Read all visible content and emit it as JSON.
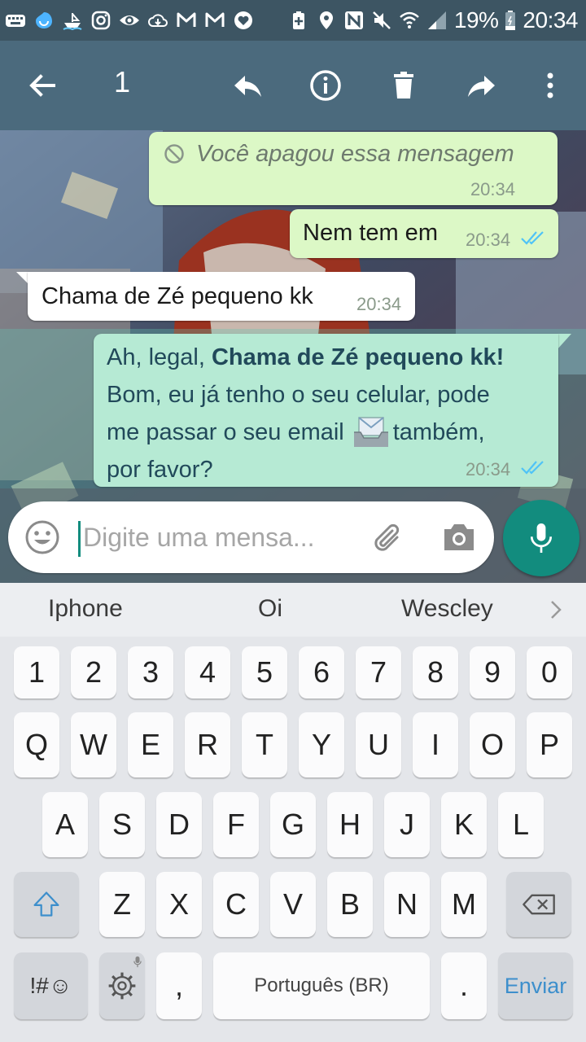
{
  "status_bar": {
    "battery": "19%",
    "time": "20:34",
    "left_icons": [
      "keyboard-icon",
      "drop-icon",
      "ship-icon",
      "instagram-icon",
      "eye-icon",
      "cloud-icon",
      "gmail-icon",
      "gmail-icon",
      "heart-icon"
    ],
    "right_icons": [
      "battery-saver-icon",
      "location-icon",
      "nfc-icon",
      "mute-icon",
      "wifi-icon",
      "signal-icon",
      "battery-icon"
    ]
  },
  "action_bar": {
    "selected_count": "1",
    "icons": [
      "back-arrow-icon",
      "reply-icon",
      "info-icon",
      "delete-icon",
      "forward-icon",
      "more-vert-icon"
    ]
  },
  "messages": [
    {
      "type": "outgoing-deleted",
      "text": "Você apagou essa mensagem",
      "time": "20:34"
    },
    {
      "type": "outgoing",
      "text": "Nem tem em",
      "time": "20:34",
      "status": "read"
    },
    {
      "type": "incoming",
      "text": "Chama de Zé pequeno kk",
      "time": "20:34"
    },
    {
      "type": "outgoing-selected",
      "text_prefix": "Ah, legal, ",
      "text_bold": "Chama de Zé pequeno kk!",
      "line2": "Bom, eu já tenho o seu celular, pode",
      "line3_start": "me passar o seu email",
      "line3_end": " também,",
      "line4": "por favor?",
      "time": "20:34",
      "status": "read",
      "emoji": "inbox-tray-emoji"
    }
  ],
  "input": {
    "placeholder": "Digite uma mensa..."
  },
  "keyboard": {
    "suggestions": [
      "Iphone",
      "Oi",
      "Wescley"
    ],
    "row_numbers": [
      "1",
      "2",
      "3",
      "4",
      "5",
      "6",
      "7",
      "8",
      "9",
      "0"
    ],
    "row_1": [
      "Q",
      "W",
      "E",
      "R",
      "T",
      "Y",
      "U",
      "I",
      "O",
      "P"
    ],
    "row_2": [
      "A",
      "S",
      "D",
      "F",
      "G",
      "H",
      "J",
      "K",
      "L"
    ],
    "row_3": [
      "Z",
      "X",
      "C",
      "V",
      "B",
      "N",
      "M"
    ],
    "symbols_label": "!#☺",
    "comma_label": ",",
    "space_label": "Português (BR)",
    "period_label": ".",
    "send_label": "Enviar"
  },
  "colors": {
    "status_bar": "#3d5563",
    "action_bar": "#4b6a7d",
    "outgoing_bubble": "#dcf8c6",
    "incoming_bubble": "#ffffff",
    "accent": "#128c7e",
    "read_ticks": "#4fc3f7"
  }
}
